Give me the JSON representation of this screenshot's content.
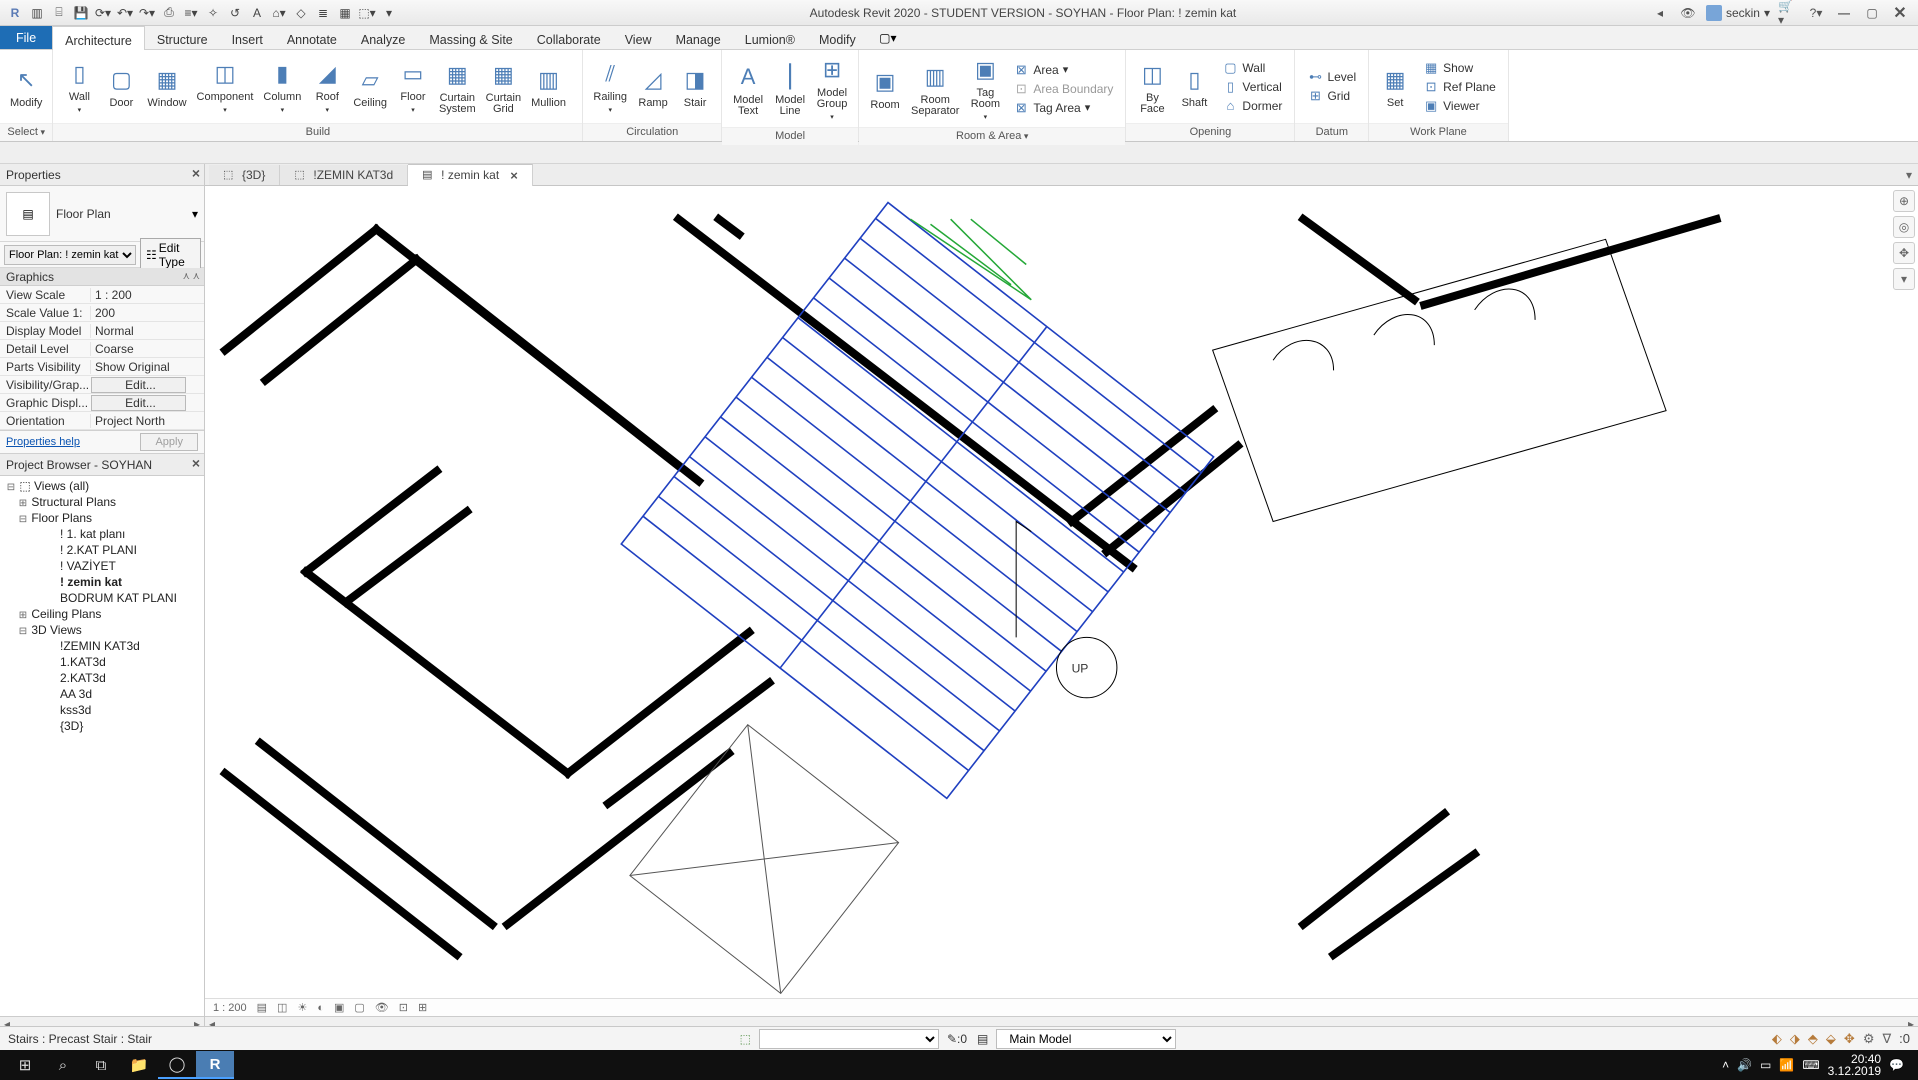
{
  "titlebar": {
    "title": "Autodesk Revit 2020 - STUDENT VERSION - SOYHAN - Floor Plan: ! zemin kat",
    "user": "seckin"
  },
  "menutabs": {
    "file": "File",
    "tabs": [
      "Architecture",
      "Structure",
      "Insert",
      "Annotate",
      "Analyze",
      "Massing & Site",
      "Collaborate",
      "View",
      "Manage",
      "Lumion®",
      "Modify"
    ],
    "active": "Architecture"
  },
  "ribbon": {
    "select": {
      "modify": "Modify",
      "label": "Select"
    },
    "build": {
      "wall": "Wall",
      "door": "Door",
      "window": "Window",
      "component": "Component",
      "column": "Column",
      "roof": "Roof",
      "ceiling": "Ceiling",
      "floor": "Floor",
      "curtainSystem": "Curtain\nSystem",
      "curtainGrid": "Curtain\nGrid",
      "mullion": "Mullion",
      "label": "Build"
    },
    "circulation": {
      "railing": "Railing",
      "ramp": "Ramp",
      "stair": "Stair",
      "label": "Circulation"
    },
    "model": {
      "modelText": "Model\nText",
      "modelLine": "Model\nLine",
      "modelGroup": "Model\nGroup",
      "label": "Model"
    },
    "room": {
      "room": "Room",
      "roomSep": "Room\nSeparator",
      "tagRoom": "Tag\nRoom",
      "area": "Area",
      "areaBoundary": "Area Boundary",
      "tagArea": "Tag Area",
      "label": "Room & Area"
    },
    "opening": {
      "byFace": "By\nFace",
      "shaft": "Shaft",
      "wall": "Wall",
      "vertical": "Vertical",
      "dormer": "Dormer",
      "label": "Opening"
    },
    "datum": {
      "level": "Level",
      "grid": "Grid",
      "label": "Datum"
    },
    "workplane": {
      "set": "Set",
      "show": "Show",
      "refPlane": "Ref Plane",
      "viewer": "Viewer",
      "label": "Work Plane"
    }
  },
  "properties": {
    "title": "Properties",
    "typeName": "Floor Plan",
    "instanceSel": "Floor Plan: ! zemin kat",
    "editType": "Edit Type",
    "group": "Graphics",
    "rows": [
      {
        "n": "View Scale",
        "v": "1 : 200"
      },
      {
        "n": "Scale Value  1:",
        "v": "200"
      },
      {
        "n": "Display Model",
        "v": "Normal"
      },
      {
        "n": "Detail Level",
        "v": "Coarse"
      },
      {
        "n": "Parts Visibility",
        "v": "Show Original"
      },
      {
        "n": "Visibility/Grap...",
        "v": "Edit...",
        "b": true
      },
      {
        "n": "Graphic Displ...",
        "v": "Edit...",
        "b": true
      },
      {
        "n": "Orientation",
        "v": "Project North"
      }
    ],
    "help": "Properties help",
    "apply": "Apply"
  },
  "browser": {
    "title": "Project Browser - SOYHAN",
    "root": "Views (all)",
    "structural": "Structural Plans",
    "floorPlans": "Floor Plans",
    "fp": [
      "! 1. kat planı",
      "! 2.KAT PLANI",
      "! VAZİYET",
      "! zemin kat",
      "BODRUM KAT PLANI"
    ],
    "fpSel": "! zemin kat",
    "ceiling": "Ceiling Plans",
    "views3d": "3D Views",
    "v3d": [
      "!ZEMIN KAT3d",
      "1.KAT3d",
      "2.KAT3d",
      "AA 3d",
      "kss3d",
      "{3D}"
    ]
  },
  "viewTabs": [
    {
      "label": "{3D}",
      "active": false,
      "close": false
    },
    {
      "label": "!ZEMIN KAT3d",
      "active": false,
      "close": false
    },
    {
      "label": "! zemin kat",
      "active": true,
      "close": true
    }
  ],
  "viewControl": {
    "scale": "1 : 200"
  },
  "canvas": {
    "upLabel": "UP"
  },
  "status": {
    "left": "Stairs : Precast Stair : Stair",
    "pressdrag": ":0",
    "mainModel": "Main Model",
    "filter": ":0"
  },
  "taskbar": {
    "time": "20:40",
    "date": "3.12.2019"
  }
}
